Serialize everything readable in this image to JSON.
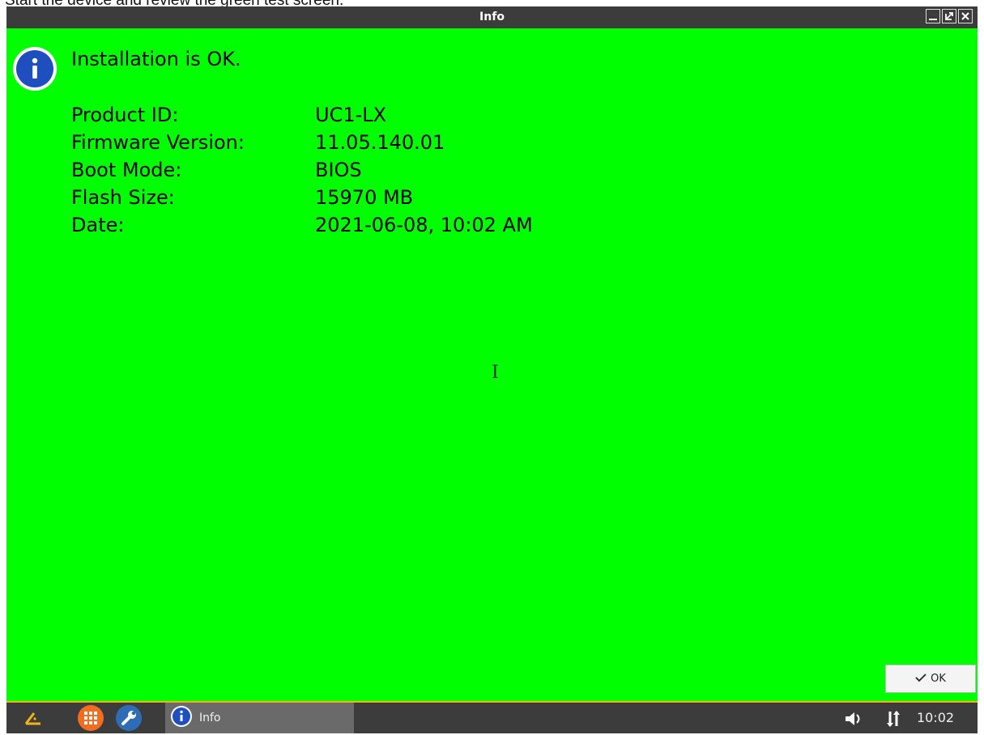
{
  "caption": "Start the device and review the green test screen.",
  "window": {
    "title": "Info",
    "controls": [
      "minimize-icon",
      "restore-icon",
      "close-icon"
    ]
  },
  "dialog": {
    "icon": "info-icon",
    "message": "Installation is OK.",
    "details": [
      {
        "label": "Product ID:",
        "value": "UC1-LX"
      },
      {
        "label": "Firmware Version:",
        "value": "11.05.140.01"
      },
      {
        "label": "Boot Mode:",
        "value": "BIOS"
      },
      {
        "label": "Flash Size:",
        "value": "15970 MB"
      },
      {
        "label": "Date:",
        "value": "2021-06-08, 10:02 AM"
      }
    ],
    "ok_label": "OK"
  },
  "taskbar": {
    "task_label": "Info",
    "clock": "10:02",
    "icons": [
      "logo-icon",
      "app-grid-icon",
      "wrench-icon",
      "info-icon",
      "volume-icon",
      "network-icon"
    ]
  },
  "colors": {
    "background": "#00ff00",
    "titlebar": "#3c3c3c",
    "taskbar": "#3c3c3c",
    "accent": "#f2b21c",
    "app_grid": "#f26d21",
    "info_blue": "#1f4fbf"
  }
}
